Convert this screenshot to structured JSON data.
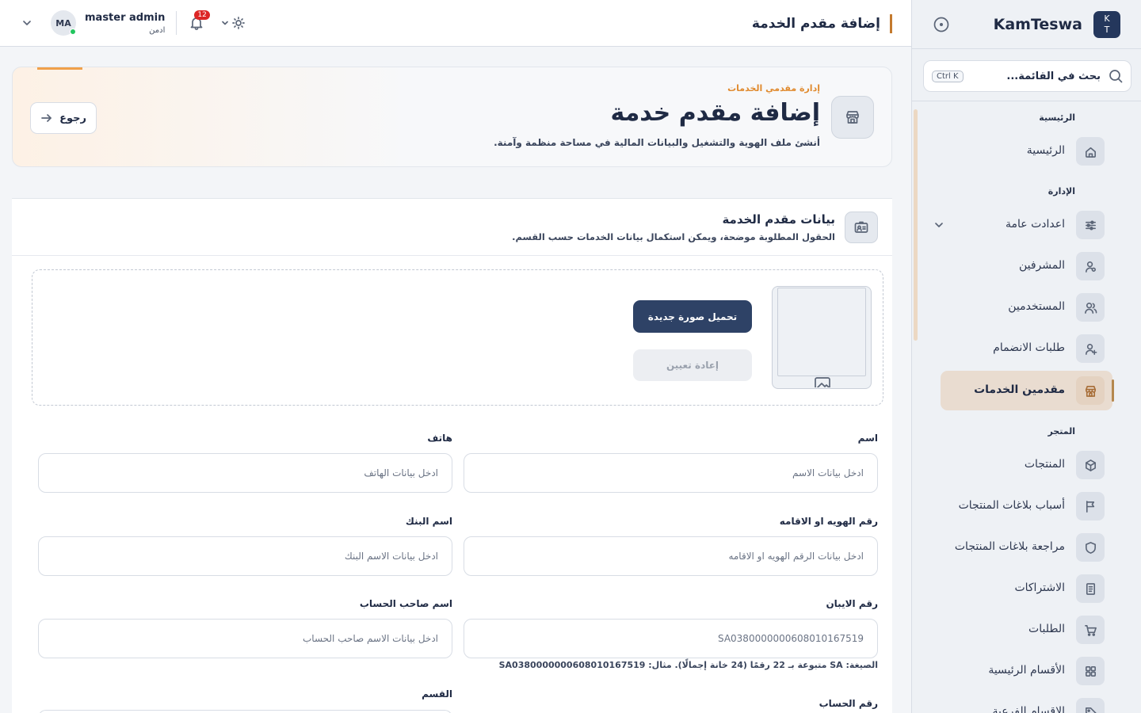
{
  "sidebar": {
    "brand": "KamTeswa",
    "logo_line1": "K",
    "logo_line2": "T",
    "search_placeholder": "بحث في القائمة...",
    "search_shortcut": "Ctrl K",
    "sections": [
      {
        "title": "الرئيسية",
        "items": [
          {
            "label": "الرئيسية",
            "icon": "home-icon"
          }
        ]
      },
      {
        "title": "الإدارة",
        "items": [
          {
            "label": "اعدادت عامة",
            "icon": "sliders-icon"
          },
          {
            "label": "المشرفين",
            "icon": "user-icon"
          },
          {
            "label": "المستخدمين",
            "icon": "users-icon"
          },
          {
            "label": "طلبات الانضمام",
            "icon": "user-plus-icon"
          },
          {
            "label": "مقدمين الخدمات",
            "icon": "store-icon"
          }
        ]
      },
      {
        "title": "المتجر",
        "items": [
          {
            "label": "المنتجات",
            "icon": "package-icon"
          },
          {
            "label": "أسباب بلاغات المنتجات",
            "icon": "flag-icon"
          },
          {
            "label": "مراجعة بلاغات المنتجات",
            "icon": "shield-icon"
          },
          {
            "label": "الاشتراكات",
            "icon": "document-icon"
          },
          {
            "label": "الطلبات",
            "icon": "cart-icon"
          },
          {
            "label": "الأقسام الرئيسية",
            "icon": "grid-icon"
          },
          {
            "label": "الاقسام الفرعية",
            "icon": "tag-icon"
          }
        ]
      }
    ]
  },
  "topbar": {
    "page_title": "إضافة مقدم الخدمة",
    "user_name": "master admin",
    "user_role": "ادمن",
    "user_initials": "MA",
    "notifications_count": "12"
  },
  "hero": {
    "kicker": "إدارة مقدمي الخدمات",
    "title": "إضافة مقدم خدمة",
    "subtitle": "أنشئ ملف الهوية والتشغيل والبيانات المالية في مساحة منظمة وآمنة.",
    "back_label": "رجوع"
  },
  "form": {
    "title": "بيانات مقدم الخدمة",
    "subtitle": "الحقول المطلوبة موضحة، ويمكن استكمال بيانات الخدمات حسب القسم.",
    "upload_label": "تحميل صورة جديدة",
    "reset_label": "إعادة تعيين",
    "fields": {
      "name": {
        "label": "اسم",
        "placeholder": "ادخل بيانات الاسم"
      },
      "phone": {
        "label": "هاتف",
        "placeholder": "ادخل بيانات الهاتف"
      },
      "id_number": {
        "label": "رقم الهويه او الاقامه",
        "placeholder": "ادخل بيانات الرقم الهويه او الاقامه"
      },
      "bank_name": {
        "label": "اسم البنك",
        "placeholder": "ادخل بيانات الاسم البنك"
      },
      "iban": {
        "label": "رقم الايبان",
        "placeholder": "SA0380000000608010167519"
      },
      "holder_name": {
        "label": "اسم صاحب الحساب",
        "placeholder": "ادخل بيانات الاسم صاحب الحساب"
      },
      "account_number": {
        "label": "رقم الحساب"
      },
      "category": {
        "label": "القسم"
      }
    },
    "iban_hint": "الصيغة: SA متبوعة بـ 22 رقمًا (24 خانة إجمالًا). مثال: SA0380000000608010167519"
  },
  "colors": {
    "accent": "#c47a2e",
    "primary": "#2e4266",
    "online": "#22c55e",
    "badge": "#dc2626"
  }
}
